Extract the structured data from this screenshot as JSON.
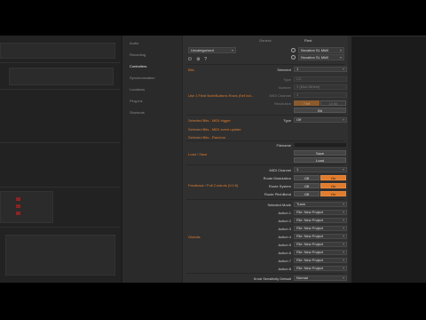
{
  "dialog": {
    "sidebar": {
      "items": [
        {
          "label": "Audio"
        },
        {
          "label": "Recording"
        },
        {
          "label": "Controllers"
        },
        {
          "label": "Synchronization"
        },
        {
          "label": "Locations"
        },
        {
          "label": "Plug-ins"
        },
        {
          "label": "Shortcuts"
        }
      ]
    },
    "header": {
      "left_label": "Generic",
      "right_label": "Flexi"
    },
    "controller": {
      "name": "Uncategorized",
      "input_port": "Novation SL MkIII",
      "output_port": "Novation SL MkIII"
    },
    "sections": {
      "bits": "Bits",
      "lookup": "Use 1 Field Note/Buttons Rows (Set Ind...",
      "selected_bits_learn": "Selected Bits - MIDI trigger",
      "selected_bits_auto": "Selected Bits - MIDI event update",
      "selected_bits_random": "Selected Bits - Random",
      "load_save": "Load / Save",
      "feedback": "Feedback / Pull Controls (V.0.8)",
      "globals": "Globals"
    },
    "props": {
      "selected": {
        "label": "Selected",
        "value": "1"
      },
      "type": {
        "label": "Type",
        "value": "CC"
      },
      "number": {
        "label": "Number",
        "value": "1 (Mod Wheel)"
      },
      "midi_channel_dim": {
        "label": "MIDI Channel",
        "value": "1"
      },
      "resolution": {
        "label": "Resolution",
        "btn1": "7 bit",
        "btn2": "14 bit"
      },
      "learn": {
        "label": "Learn",
        "value": "Bit"
      },
      "trigger_type": {
        "label": "Type",
        "value": "Off"
      },
      "filename": {
        "label": "Filename",
        "value": ""
      },
      "save": "Save",
      "load": "Load",
      "midi_channel": {
        "label": "MIDI Channel",
        "value": "1"
      },
      "route_modulation": {
        "label": "Route Modulation",
        "off": "Off",
        "on": "On"
      },
      "route_system": {
        "label": "Route System",
        "off": "Off",
        "on": "On"
      },
      "route_pitchbend": {
        "label": "Route PitchBend",
        "off": "Off",
        "on": "On"
      },
      "selected_mode": {
        "label": "Selected Mode",
        "value": "Track"
      },
      "actions": [
        {
          "label": "Action 1",
          "value": "File: New Project"
        },
        {
          "label": "Action 2",
          "value": "File: New Project"
        },
        {
          "label": "Action 3",
          "value": "File: New Project"
        },
        {
          "label": "Action 4",
          "value": "File: New Project"
        },
        {
          "label": "Action 5",
          "value": "File: New Project"
        },
        {
          "label": "Action 6",
          "value": "File: New Project"
        },
        {
          "label": "Action 7",
          "value": "File: New Project"
        },
        {
          "label": "Action 8",
          "value": "File: New Project"
        }
      ],
      "knob_sensitivity": {
        "label": "Knob Sensitivity Default",
        "value": "Normal"
      }
    }
  },
  "colors": {
    "accent": "#e07c2e",
    "dialog_bg": "#303030",
    "sidebar_bg": "#2a2a2a"
  }
}
